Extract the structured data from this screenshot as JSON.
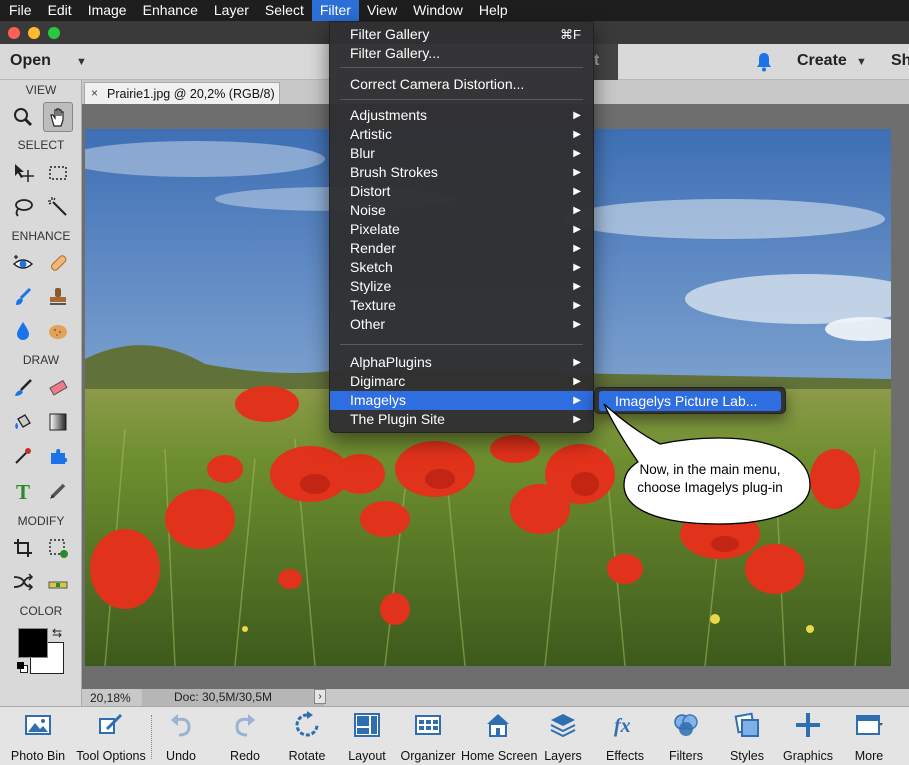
{
  "menubar": {
    "items": [
      "File",
      "Edit",
      "Image",
      "Enhance",
      "Layer",
      "Select",
      "Filter",
      "View",
      "Window",
      "Help"
    ],
    "active": "Filter"
  },
  "appbar": {
    "open_label": "Open",
    "mode_partial": "t",
    "create_label": "Create",
    "share_partial": "Sh"
  },
  "document": {
    "tab_title": "Prairie1.jpg @ 20,2% (RGB/8)",
    "close_glyph": "×"
  },
  "toolbox": {
    "sections": [
      "VIEW",
      "SELECT",
      "ENHANCE",
      "DRAW",
      "MODIFY",
      "COLOR"
    ]
  },
  "statusbar": {
    "zoom": "20,18%",
    "doc_size": "Doc: 30,5M/30,5M",
    "arrow": "›"
  },
  "bottombar": {
    "items": [
      "Photo Bin",
      "Tool Options",
      "Undo",
      "Redo",
      "Rotate",
      "Layout",
      "Organizer",
      "Home Screen",
      "Layers",
      "Effects",
      "Filters",
      "Styles",
      "Graphics",
      "More"
    ]
  },
  "filter_menu": {
    "filter_gallery": "Filter Gallery",
    "filter_gallery_shortcut": "⌘F",
    "filter_gallery_dialog": "Filter Gallery...",
    "correct_camera": "Correct Camera Distortion...",
    "categories": [
      "Adjustments",
      "Artistic",
      "Blur",
      "Brush Strokes",
      "Distort",
      "Noise",
      "Pixelate",
      "Render",
      "Sketch",
      "Stylize",
      "Texture",
      "Other"
    ],
    "plugins": [
      "AlphaPlugins",
      "Digimarc",
      "Imagelys",
      "The Plugin Site"
    ],
    "highlighted": "Imagelys"
  },
  "submenu": {
    "item": "Imagelys Picture Lab..."
  },
  "callout": {
    "line1": "Now, in the main menu,",
    "line2": "choose Imagelys plug-in"
  },
  "colors": {
    "accent": "#2f6ee0",
    "menu_bg": "#303032",
    "menubar_bg": "#1e1e1e"
  }
}
